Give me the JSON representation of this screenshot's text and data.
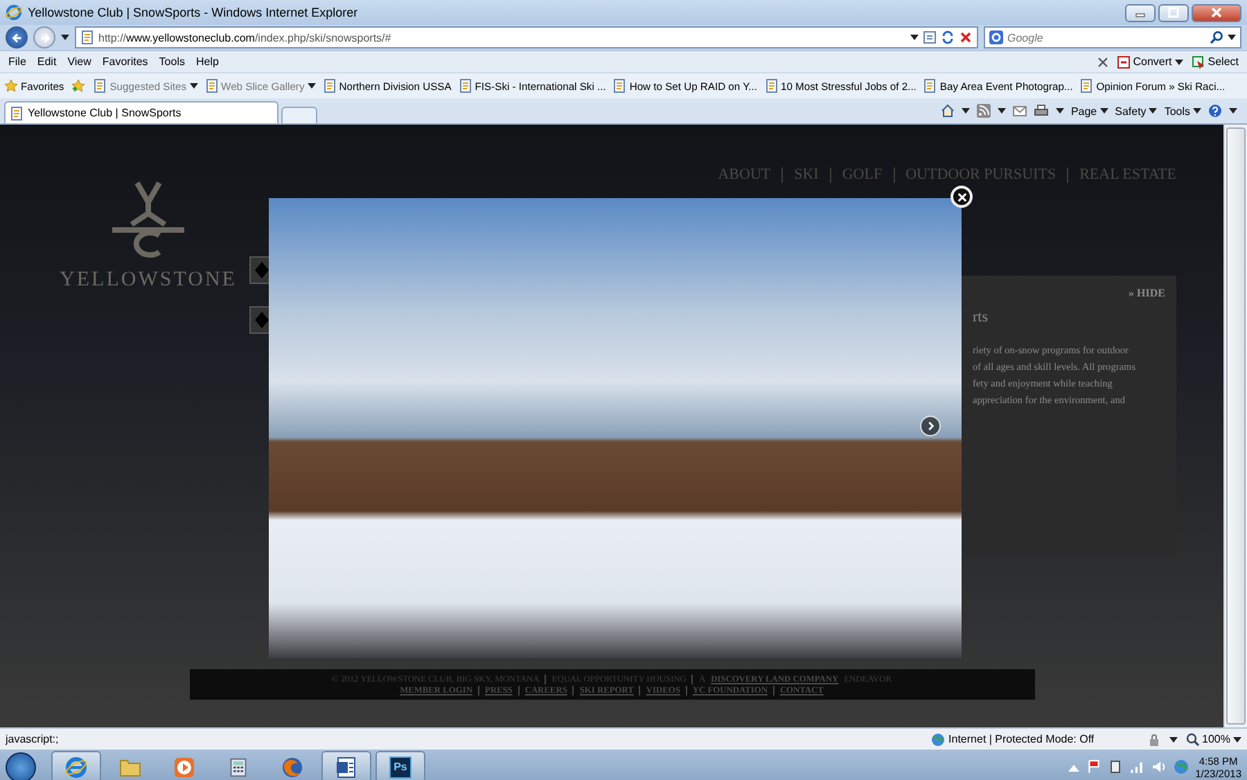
{
  "window": {
    "title": "Yellowstone Club | SnowSports - Windows Internet Explorer"
  },
  "address_bar": {
    "url": "http://**www.yellowstoneclub.com**/index.php/ski/snowsports/#"
  },
  "search": {
    "placeholder": "Google"
  },
  "menu": [
    "File",
    "Edit",
    "View",
    "Favorites",
    "Tools",
    "Help"
  ],
  "toolbar_right": [
    {
      "label": "Convert",
      "kind": "convert"
    },
    {
      "label": "Select",
      "kind": "select"
    }
  ],
  "favorites_bar": {
    "label": "Favorites",
    "items": [
      {
        "label": "Suggested Sites",
        "kind": "dropdown"
      },
      {
        "label": "Web Slice Gallery",
        "kind": "dropdown"
      },
      {
        "label": "Northern Division USSA",
        "kind": "link"
      },
      {
        "label": "FIS-Ski - International Ski ...",
        "kind": "link"
      },
      {
        "label": "How to Set Up RAID on Y...",
        "kind": "link"
      },
      {
        "label": "10 Most Stressful Jobs of 2...",
        "kind": "link"
      },
      {
        "label": "Bay Area Event Photograp...",
        "kind": "link"
      },
      {
        "label": "Opinion Forum » Ski Raci...",
        "kind": "link"
      }
    ]
  },
  "tabs": [
    {
      "label": "Yellowstone Club | SnowSports",
      "selected": true
    }
  ],
  "command_bar": [
    "Page",
    "Safety",
    "Tools"
  ],
  "page": {
    "logo": "YELLOWSTONE",
    "nav": [
      "ABOUT",
      "SKI",
      "GOLF",
      "OUTDOOR PURSUITS",
      "REAL ESTATE"
    ],
    "panel": {
      "hide": "» HIDE",
      "heading": "rts",
      "lines": [
        "riety of on-snow programs for outdoor",
        "of all ages and skill levels. All programs",
        "fety and enjoyment while teaching",
        "appreciation for the environment, and"
      ]
    },
    "footer": {
      "copyright": "© 2012 YELLOWSTONE CLUB, BIG SKY, MONTANA",
      "links_top": [
        "EQUAL OPPORTUNITY HOUSING"
      ],
      "endeavor_link": "A DISCOVERY LAND COMPANY",
      "endeavor": "ENDEAVOR",
      "links": [
        "MEMBER LOGIN",
        "PRESS",
        "CAREERS",
        "SKI REPORT",
        "VIDEOS",
        "YC FOUNDATION",
        "CONTACT"
      ]
    }
  },
  "status_bar": {
    "text": "javascript:;",
    "zone": "Internet | Protected Mode: Off",
    "zoom": "100%"
  },
  "taskbar": {
    "apps": [
      {
        "kind": "ie",
        "selected": true
      },
      {
        "kind": "folder",
        "selected": false
      },
      {
        "kind": "media",
        "selected": false
      },
      {
        "kind": "calculator",
        "selected": false
      },
      {
        "kind": "firefox",
        "selected": false
      },
      {
        "kind": "word",
        "selected": true
      },
      {
        "kind": "photoshop",
        "label": "Ps",
        "selected": true
      }
    ],
    "time": "4:58 PM",
    "date": "1/23/2013"
  }
}
